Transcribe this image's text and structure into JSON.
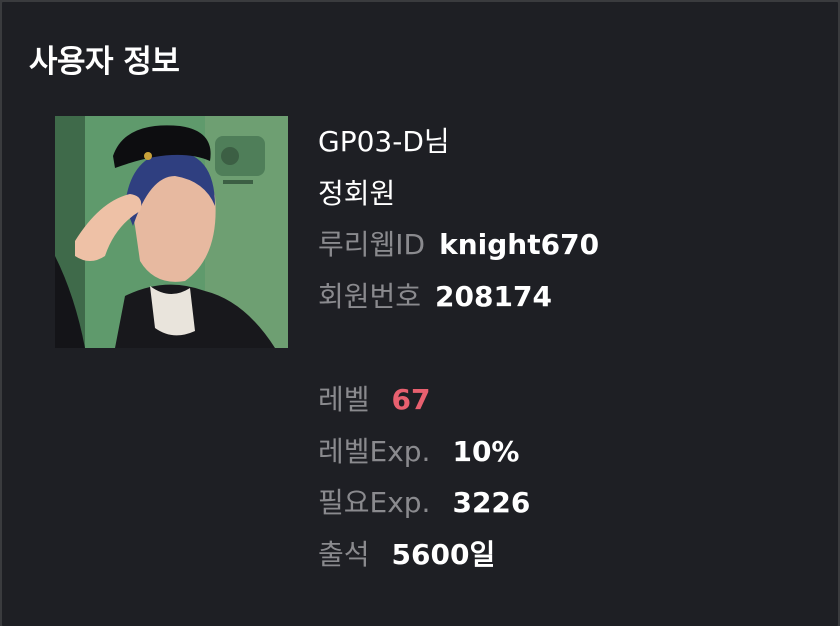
{
  "header": {
    "title": "사용자 정보"
  },
  "user": {
    "nickname": "GP03-D님",
    "grade": "정회원"
  },
  "fields": {
    "ruliweb_id": {
      "label": "루리웹ID",
      "value": "knight670"
    },
    "member_no": {
      "label": "회원번호",
      "value": "208174"
    },
    "level": {
      "label": "레벨",
      "value": "67"
    },
    "level_exp": {
      "label": "레벨Exp.",
      "value": "10%"
    },
    "need_exp": {
      "label": "필요Exp.",
      "value": "3226"
    },
    "attendance": {
      "label": "출석",
      "value": "5600일"
    }
  },
  "colors": {
    "background": "#1e1f24",
    "label": "#8a8a8e",
    "value": "#ffffff",
    "level_accent": "#e8606f"
  },
  "avatar": {
    "icon": "user-avatar-image"
  }
}
